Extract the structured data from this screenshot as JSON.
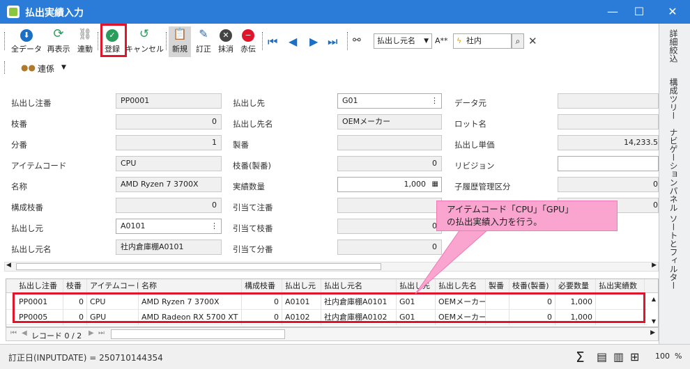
{
  "window": {
    "title": "払出実績入力",
    "minimize": "—",
    "maximize": "☐",
    "close": "✕"
  },
  "toolbar": {
    "buttons": [
      {
        "label": "全データ",
        "icon": "download-icon"
      },
      {
        "label": "再表示",
        "icon": "refresh-icon"
      },
      {
        "label": "連動",
        "icon": "link-icon"
      },
      {
        "label": "登録",
        "icon": "check-icon"
      },
      {
        "label": "キャンセル",
        "icon": "undo-icon"
      },
      {
        "label": "新規",
        "icon": "clipboard-icon"
      },
      {
        "label": "訂正",
        "icon": "pencil-icon"
      },
      {
        "label": "抹消",
        "icon": "delete-icon"
      },
      {
        "label": "赤伝",
        "icon": "minus-icon"
      }
    ],
    "search_field": "払出し元名",
    "search_mode": "A**",
    "search_value": "社内",
    "link_menu": "連係"
  },
  "side_panel": [
    "詳細絞込",
    "構成ツリー",
    "ナビゲーションパネル",
    "ソートとフィルター"
  ],
  "form": {
    "col1": [
      {
        "label": "払出し注番",
        "value": "PP0001"
      },
      {
        "label": "枝番",
        "value": "0"
      },
      {
        "label": "分番",
        "value": "1"
      },
      {
        "label": "アイテムコード",
        "value": "CPU"
      },
      {
        "label": "名称",
        "value": "AMD Ryzen 7 3700X"
      },
      {
        "label": "構成枝番",
        "value": "0"
      },
      {
        "label": "払出し元",
        "value": "A0101"
      },
      {
        "label": "払出し元名",
        "value": "社内倉庫棚A0101"
      }
    ],
    "col2": [
      {
        "label": "払出し先",
        "value": "G01"
      },
      {
        "label": "払出し先名",
        "value": "OEMメーカー"
      },
      {
        "label": "製番",
        "value": ""
      },
      {
        "label": "枝番(製番)",
        "value": "0"
      },
      {
        "label": "実績数量",
        "value": "1,000"
      },
      {
        "label": "引当て注番",
        "value": ""
      },
      {
        "label": "引当て枝番",
        "value": "0"
      },
      {
        "label": "引当て分番",
        "value": "0"
      }
    ],
    "col3": [
      {
        "label": "データ元",
        "value": ""
      },
      {
        "label": "ロット名",
        "value": ""
      },
      {
        "label": "払出し単価",
        "value": "14,233.5"
      },
      {
        "label": "リビジョン",
        "value": ""
      },
      {
        "label": "子履歴管理区分",
        "value": "0"
      },
      {
        "label": "",
        "value": "0"
      }
    ]
  },
  "grid": {
    "columns": [
      "払出し注番",
      "枝番",
      "アイテムコード",
      "名称",
      "構成枝番",
      "払出し元",
      "払出し元名",
      "払出し先",
      "払出し先名",
      "製番",
      "枝番(製番)",
      "必要数量",
      "払出実績数"
    ],
    "rows": [
      [
        "PP0001",
        "0",
        "CPU",
        "AMD Ryzen 7 3700X",
        "0",
        "A0101",
        "社内倉庫棚A0101",
        "G01",
        "OEMメーカー",
        "",
        "0",
        "1,000",
        ""
      ],
      [
        "PP0005",
        "0",
        "GPU",
        "AMD Radeon RX 5700 XT",
        "0",
        "A0102",
        "社内倉庫棚A0102",
        "G01",
        "OEMメーカー",
        "",
        "0",
        "1,000",
        ""
      ]
    ]
  },
  "pager": {
    "text": "レコード 0 / 2"
  },
  "status": {
    "text": "訂正日(INPUTDATE) = 250710144354",
    "zoom": "100",
    "zoom_unit": "%"
  },
  "callout": {
    "line1": "アイテムコード「CPU」「GPU」",
    "line2": "の払出実績入力を行う。"
  },
  "colors": {
    "titlebar": "#2b7bd8",
    "highlight": "#e0142b",
    "callout": "#f9a5cf",
    "accent": "#1b6fc4"
  }
}
